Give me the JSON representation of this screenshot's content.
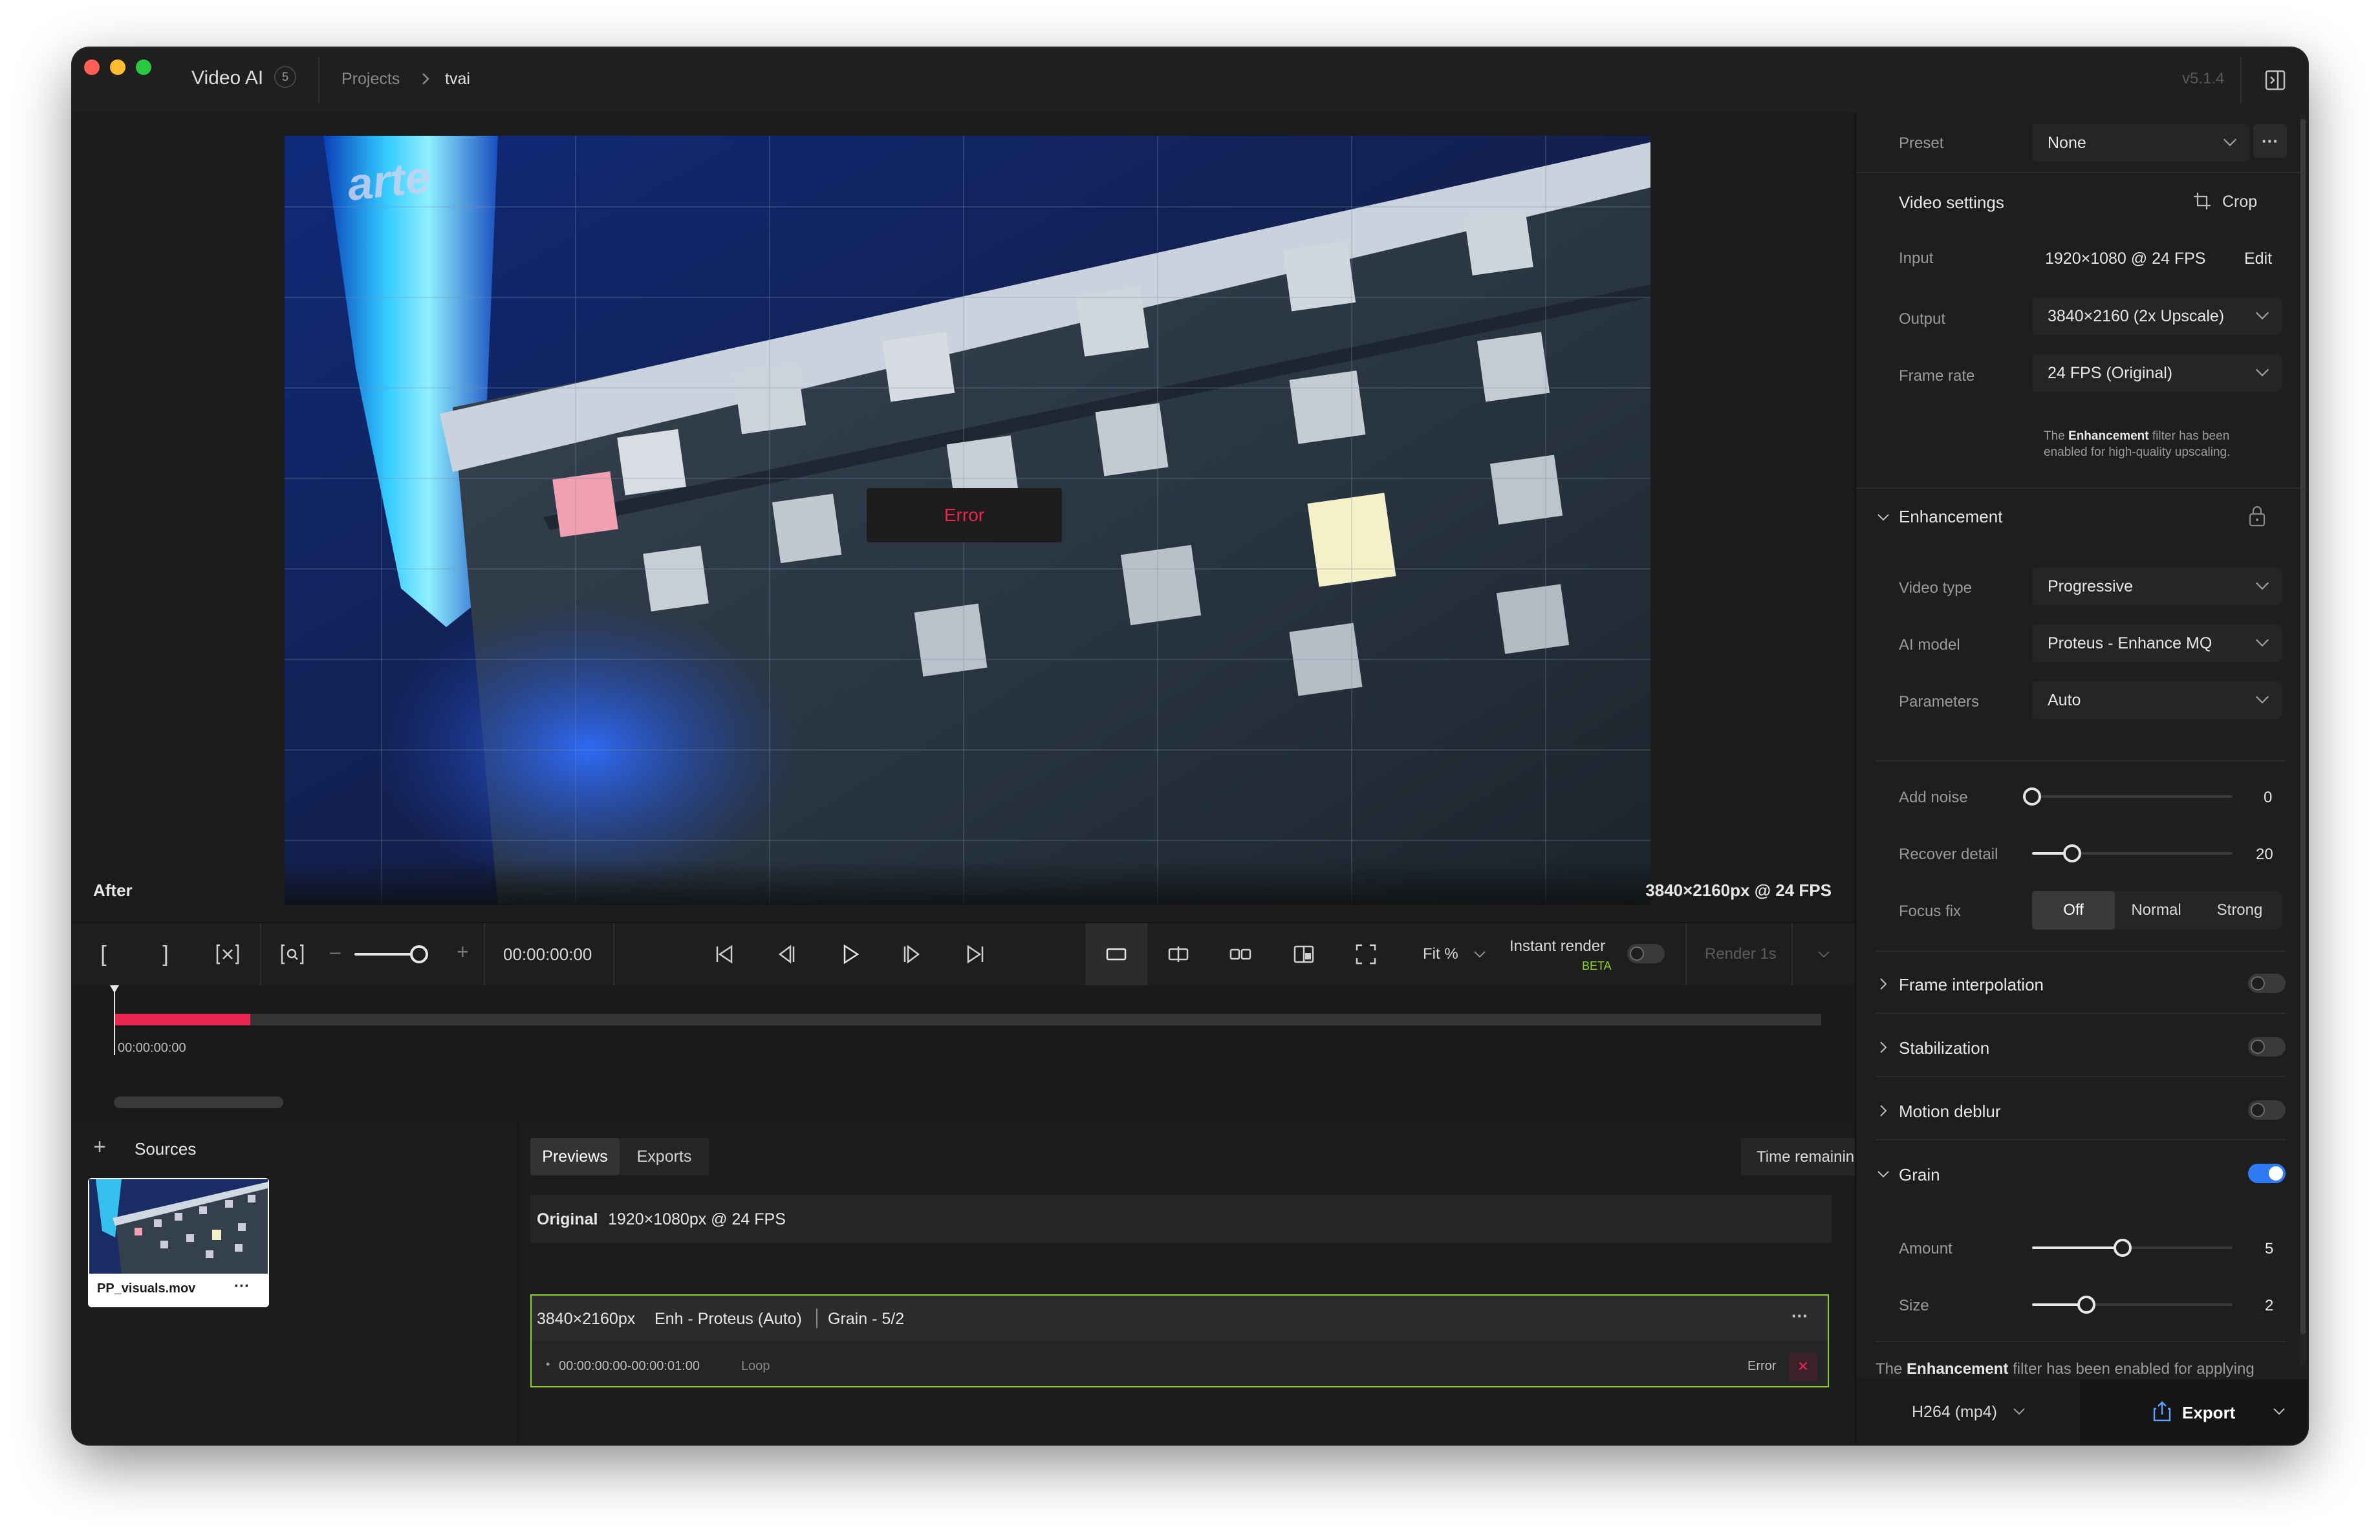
{
  "window": {
    "app_name": "Video AI",
    "app_badge": "5",
    "breadcrumb": {
      "projects": "Projects",
      "current": "tvai"
    },
    "version": "v5.1.4"
  },
  "preview": {
    "error_label": "Error",
    "view_label": "After",
    "resolution_label": "3840×2160px @ 24 FPS",
    "watermark_text": "arte"
  },
  "controls": {
    "mark_in": "[",
    "mark_out": "]",
    "timecode": "00:00:00:00",
    "zoom_minus": "–",
    "zoom_plus": "+",
    "zoom_level": 0.6,
    "fit_label": "Fit %",
    "instant_render_label": "Instant render",
    "instant_render_beta": "BETA",
    "render_label": "Render 1s"
  },
  "timeline": {
    "playhead_time": "00:00:00:00",
    "progress_fraction": 0.08
  },
  "sources": {
    "title": "Sources",
    "items": [
      {
        "name": "PP_visuals.mov",
        "more": "···"
      }
    ]
  },
  "previews": {
    "tabs": [
      {
        "label": "Previews",
        "active": true
      },
      {
        "label": "Exports",
        "active": false
      }
    ],
    "sort_label": "Time remaining",
    "original_label": "Original",
    "original_info": "1920×1080px @ 24 FPS",
    "job": {
      "resolution": "3840×2160px",
      "model": "Enh - Proteus (Auto)",
      "grain": "Grain - 5/2",
      "range": "00:00:00:00-00:00:01:00",
      "loop": "Loop",
      "status": "Error",
      "more": "···",
      "bullet": "•",
      "close": "✕"
    }
  },
  "panel": {
    "preset": {
      "label": "Preset",
      "value": "None",
      "more": "···"
    },
    "video_settings": {
      "title": "Video settings",
      "crop": "Crop"
    },
    "input": {
      "label": "Input",
      "value": "1920×1080 @ 24 FPS",
      "edit": "Edit"
    },
    "output": {
      "label": "Output",
      "value": "3840×2160 (2x Upscale)"
    },
    "frame_rate": {
      "label": "Frame rate",
      "value": "24 FPS (Original)"
    },
    "note": {
      "prefix": "The ",
      "bold": "Enhancement",
      "suffix": " filter has been",
      "line2": "enabled for high-quality upscaling."
    },
    "enhancement": {
      "title": "Enhancement",
      "video_type": {
        "label": "Video type",
        "value": "Progressive"
      },
      "ai_model": {
        "label": "AI model",
        "value": "Proteus - Enhance MQ"
      },
      "parameters": {
        "label": "Parameters",
        "value": "Auto"
      },
      "add_noise": {
        "label": "Add noise",
        "value": "0",
        "fraction": 0.0
      },
      "recover_detail": {
        "label": "Recover detail",
        "value": "20",
        "fraction": 0.2
      },
      "focus_fix": {
        "label": "Focus fix",
        "options": [
          "Off",
          "Normal",
          "Strong"
        ],
        "selected": "Off"
      }
    },
    "frame_interpolation": {
      "title": "Frame interpolation",
      "enabled": false
    },
    "stabilization": {
      "title": "Stabilization",
      "enabled": false
    },
    "motion_deblur": {
      "title": "Motion deblur",
      "enabled": false
    },
    "grain": {
      "title": "Grain",
      "enabled": true,
      "amount": {
        "label": "Amount",
        "value": "5",
        "fraction": 0.45
      },
      "size": {
        "label": "Size",
        "value": "2",
        "fraction": 0.27
      }
    },
    "footer_note": {
      "prefix": "The ",
      "bold": "Enhancement",
      "suffix": " filter has been enabled for applying"
    },
    "export": {
      "format": "H264 (mp4)",
      "label": "Export"
    }
  },
  "colors": {
    "accent_red": "#e8264f",
    "accent_green": "#8fcf28",
    "toggle_on": "#2f7bf6"
  }
}
